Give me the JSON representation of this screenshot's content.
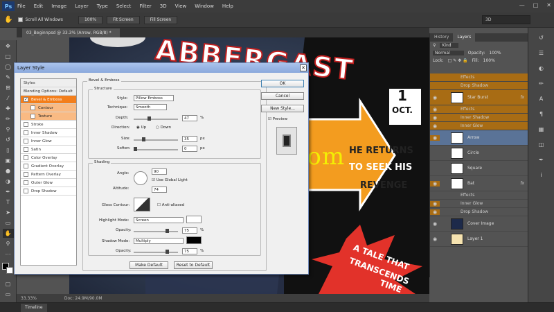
{
  "menubar": {
    "logo": "Ps",
    "items": [
      "File",
      "Edit",
      "Image",
      "Layer",
      "Type",
      "Select",
      "Filter",
      "3D",
      "View",
      "Window",
      "Help"
    ]
  },
  "options": {
    "scroll_all_label": "Scroll All Windows",
    "btn_100": "100%",
    "btn_fit": "Fit Screen",
    "btn_fill": "Fill Screen",
    "workspace": "3D"
  },
  "document": {
    "tab_label": "03_Beginnpsd @ 33.3% (Arrow, RGB/8) *",
    "zoom": "33.33%",
    "doc_info": "Doc: 24.9M/90.0M"
  },
  "poster": {
    "title": "ABBERGAST",
    "date_day": "1",
    "date_month": "OCT.",
    "arrow_line1": "HE RETURNS",
    "arrow_line2": "TO SEEK HIS",
    "arrow_line3": "REVENGE",
    "tag_line1": "A TALE THAT",
    "tag_line2": "TRANSCENDS",
    "tag_line3": "TIME",
    "watermark": "www.cgtsj.com"
  },
  "dialog": {
    "title": "Layer Style",
    "styles_header": "Styles",
    "blending": "Blending Options: Default",
    "items": [
      {
        "label": "Bevel & Emboss",
        "checked": true,
        "state": "selected"
      },
      {
        "label": "Contour",
        "checked": false,
        "state": "sub"
      },
      {
        "label": "Texture",
        "checked": false,
        "state": "sub"
      },
      {
        "label": "Stroke",
        "checked": false,
        "state": ""
      },
      {
        "label": "Inner Shadow",
        "checked": false,
        "state": ""
      },
      {
        "label": "Inner Glow",
        "checked": false,
        "state": ""
      },
      {
        "label": "Satin",
        "checked": false,
        "state": ""
      },
      {
        "label": "Color Overlay",
        "checked": false,
        "state": ""
      },
      {
        "label": "Gradient Overlay",
        "checked": false,
        "state": ""
      },
      {
        "label": "Pattern Overlay",
        "checked": false,
        "state": ""
      },
      {
        "label": "Outer Glow",
        "checked": false,
        "state": ""
      },
      {
        "label": "Drop Shadow",
        "checked": false,
        "state": ""
      }
    ],
    "bevel_title": "Bevel & Emboss",
    "structure_title": "Structure",
    "style_label": "Style:",
    "style_value": "Pillow Emboss",
    "technique_label": "Technique:",
    "technique_value": "Smooth",
    "depth_label": "Depth:",
    "depth_value": "47",
    "direction_label": "Direction:",
    "dir_up": "Up",
    "dir_down": "Down",
    "size_label": "Size:",
    "size_value": "35",
    "soften_label": "Soften:",
    "soften_value": "0",
    "unit_pct": "%",
    "unit_px": "px",
    "shading_title": "Shading",
    "angle_label": "Angle:",
    "angle_value": "90",
    "global_light": "Use Global Light",
    "altitude_label": "Altitude:",
    "altitude_value": "74",
    "gloss_label": "Gloss Contour:",
    "anti_aliased": "Anti-aliased",
    "highlight_label": "Highlight Mode:",
    "highlight_value": "Screen",
    "hl_opacity_label": "Opacity:",
    "hl_opacity_value": "75",
    "shadow_label": "Shadow Mode:",
    "shadow_value": "Multiply",
    "sh_opacity_label": "Opacity:",
    "sh_opacity_value": "75",
    "make_default": "Make Default",
    "reset_default": "Reset to Default",
    "ok": "OK",
    "cancel": "Cancel",
    "new_style": "New Style...",
    "preview": "Preview"
  },
  "layers_panel": {
    "tabs": [
      "History",
      "Layers"
    ],
    "kind": "Kind",
    "blend": "Normal",
    "opacity_label": "Opacity:",
    "opacity": "100%",
    "lock_label": "Lock:",
    "fill_label": "Fill:",
    "fill": "100%",
    "rows": [
      {
        "name": "Effects",
        "kind": "sub"
      },
      {
        "name": "Drop Shadow",
        "kind": "sub"
      },
      {
        "name": "Star Burst",
        "kind": "layer",
        "fx": "fx"
      },
      {
        "name": "Effects",
        "kind": "sub"
      },
      {
        "name": "Inner Shadow",
        "kind": "sub"
      },
      {
        "name": "Inner Glow",
        "kind": "sub"
      },
      {
        "name": "Arrow",
        "kind": "layer",
        "fx": ""
      },
      {
        "name": "Circle",
        "kind": "layer",
        "fx": ""
      },
      {
        "name": "Square",
        "kind": "layer",
        "fx": ""
      },
      {
        "name": "Bat",
        "kind": "layer",
        "fx": "fx"
      },
      {
        "name": "Effects",
        "kind": "sub"
      },
      {
        "name": "Inner Glow",
        "kind": "sub"
      },
      {
        "name": "Drop Shadow",
        "kind": "sub"
      },
      {
        "name": "Cover Image",
        "kind": "layer",
        "fx": ""
      },
      {
        "name": "Layer 1",
        "kind": "layer",
        "fx": ""
      }
    ]
  },
  "timeline": {
    "tab": "Timeline"
  }
}
